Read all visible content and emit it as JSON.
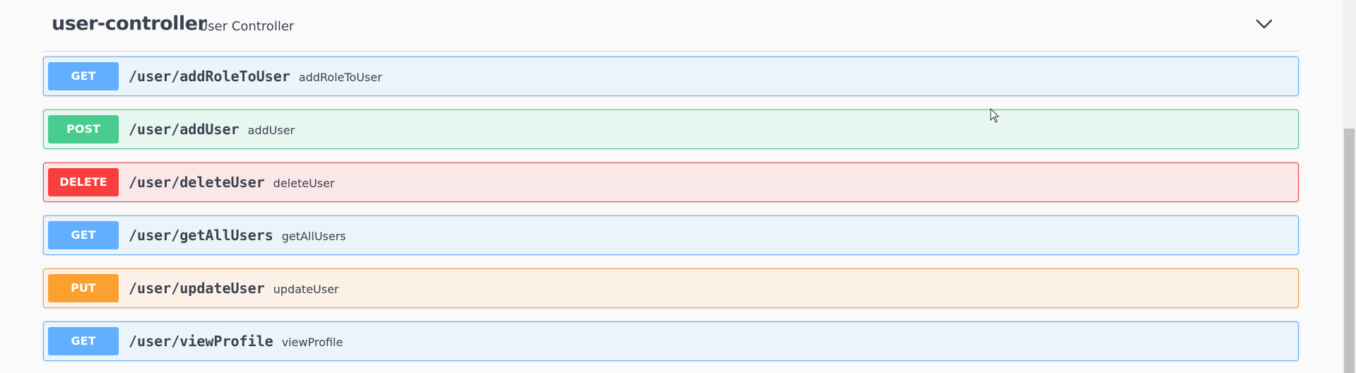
{
  "section": {
    "title": "user-controller",
    "description": "User Controller",
    "toggle_icon": "chevron-down-icon"
  },
  "operations": [
    {
      "method": "GET",
      "path": "/user/addRoleToUser",
      "summary": "addRoleToUser"
    },
    {
      "method": "POST",
      "path": "/user/addUser",
      "summary": "addUser"
    },
    {
      "method": "DELETE",
      "path": "/user/deleteUser",
      "summary": "deleteUser"
    },
    {
      "method": "GET",
      "path": "/user/getAllUsers",
      "summary": "getAllUsers"
    },
    {
      "method": "PUT",
      "path": "/user/updateUser",
      "summary": "updateUser"
    },
    {
      "method": "GET",
      "path": "/user/viewProfile",
      "summary": "viewProfile"
    }
  ],
  "colors": {
    "get": "#61affe",
    "post": "#49cc90",
    "delete": "#f93e3e",
    "put": "#fca130",
    "text": "#3b4151"
  }
}
